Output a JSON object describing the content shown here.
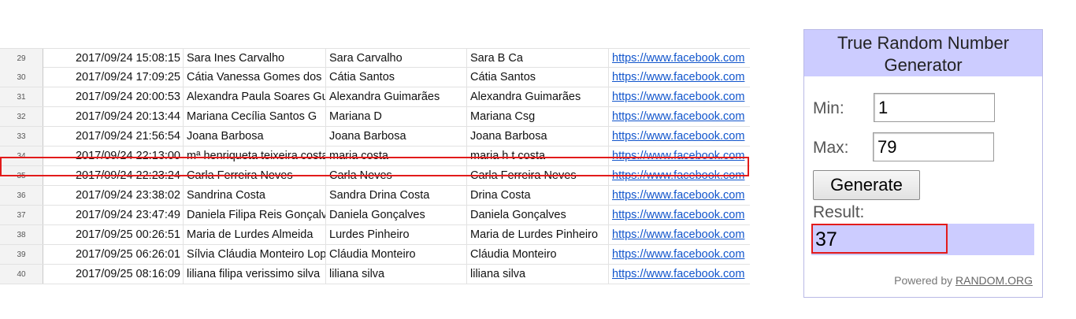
{
  "rows": [
    {
      "num": "29",
      "ts": "2017/09/24 15:08:15",
      "name": "Sara Ines Carvalho",
      "short": "Sara Carvalho",
      "nick": "Sara B Ca",
      "link": "https://www.facebook.com"
    },
    {
      "num": "30",
      "ts": "2017/09/24 17:09:25",
      "name": "Cátia Vanessa Gomes dos",
      "short": "Cátia Santos",
      "nick": "Cátia Santos",
      "link": "https://www.facebook.com"
    },
    {
      "num": "31",
      "ts": "2017/09/24 20:00:53",
      "name": "Alexandra Paula Soares Guimarães",
      "short": "Alexandra Guimarães",
      "nick": "Alexandra Guimarães",
      "link": "https://www.facebook.com"
    },
    {
      "num": "32",
      "ts": "2017/09/24 20:13:44",
      "name": "Mariana Cecília Santos G",
      "short": "Mariana D",
      "nick": "Mariana Csg",
      "link": "https://www.facebook.com"
    },
    {
      "num": "33",
      "ts": "2017/09/24 21:56:54",
      "name": "Joana Barbosa",
      "short": "Joana Barbosa",
      "nick": "Joana Barbosa",
      "link": "https://www.facebook.com"
    },
    {
      "num": "34",
      "ts": "2017/09/24 22:13:00",
      "name": "mª henriqueta teixeira costa",
      "short": "maria costa",
      "nick": "maria h t costa",
      "link": "https://www.facebook.com"
    },
    {
      "num": "35",
      "ts": "2017/09/24 22:23:24",
      "name": "Carla Ferreira Neves",
      "short": "Carla Neves",
      "nick": "Carla Ferreira Neves",
      "link": "https://www.facebook.com"
    },
    {
      "num": "36",
      "ts": "2017/09/24 23:38:02",
      "name": "Sandrina Costa",
      "short": "Sandra Drina Costa",
      "nick": "Drina Costa",
      "link": "https://www.facebook.com"
    },
    {
      "num": "37",
      "ts": "2017/09/24 23:47:49",
      "name": "Daniela Filipa Reis Gonçalves",
      "short": "Daniela Gonçalves",
      "nick": "Daniela Gonçalves",
      "link": "https://www.facebook.com"
    },
    {
      "num": "38",
      "ts": "2017/09/25 00:26:51",
      "name": "Maria de Lurdes Almeida",
      "short": "Lurdes Pinheiro",
      "nick": "Maria de Lurdes Pinheiro",
      "link": "https://www.facebook.com"
    },
    {
      "num": "39",
      "ts": "2017/09/25 06:26:01",
      "name": "Sílvia Cláudia Monteiro Lopes",
      "short": "Cláudia Monteiro",
      "nick": "Cláudia Monteiro",
      "link": "https://www.facebook.com"
    },
    {
      "num": "40",
      "ts": "2017/09/25 08:16:09",
      "name": "liliana filipa verissimo silva",
      "short": "liliana silva",
      "nick": "liliana silva",
      "link": "https://www.facebook.com"
    }
  ],
  "widget": {
    "title": "True Random Number Generator",
    "min_label": "Min:",
    "min_value": "1",
    "max_label": "Max:",
    "max_value": "79",
    "generate_label": "Generate",
    "result_label": "Result:",
    "result_value": "37",
    "powered_by": "Powered by",
    "powered_link": "RANDOM.ORG"
  },
  "colors": {
    "highlight": "#e21b1b",
    "widget_accent": "#ccccff",
    "link": "#1155cc"
  }
}
